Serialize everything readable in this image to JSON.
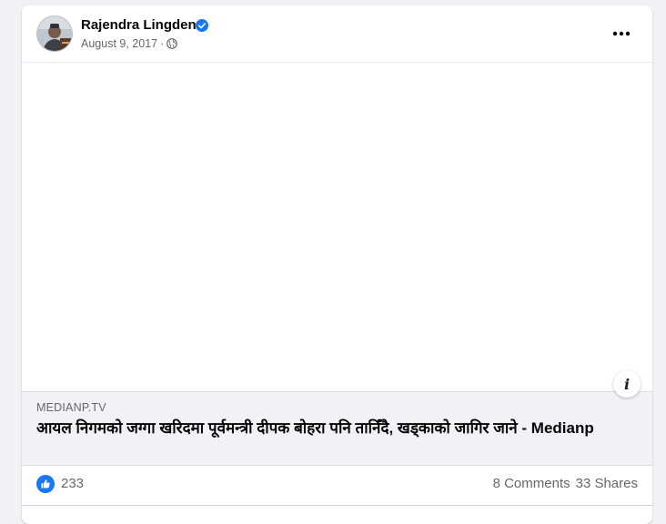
{
  "post": {
    "author": "Rajendra Lingden",
    "date": "August 9, 2017",
    "separator": "·",
    "privacy_icon": "globe-icon",
    "verified_icon": "verified-badge-icon",
    "more_icon": "more-options-icon"
  },
  "link_preview": {
    "domain": "MEDIANP.TV",
    "title": "आयल निगमको जग्गा खरिदमा पूर्वमन्त्री दीपक बोहरा पनि तानिँदै, खड्काको जागिर जाने - Medianp",
    "info_label": "i"
  },
  "engagement": {
    "reaction_icon": "like-icon",
    "reaction_count": "233",
    "comments": "8 Comments",
    "shares": "33 Shares"
  },
  "colors": {
    "accent": "#1877f2",
    "secondary_text": "#65676b",
    "primary_text": "#050505",
    "preview_bg": "#f0f2f5"
  }
}
